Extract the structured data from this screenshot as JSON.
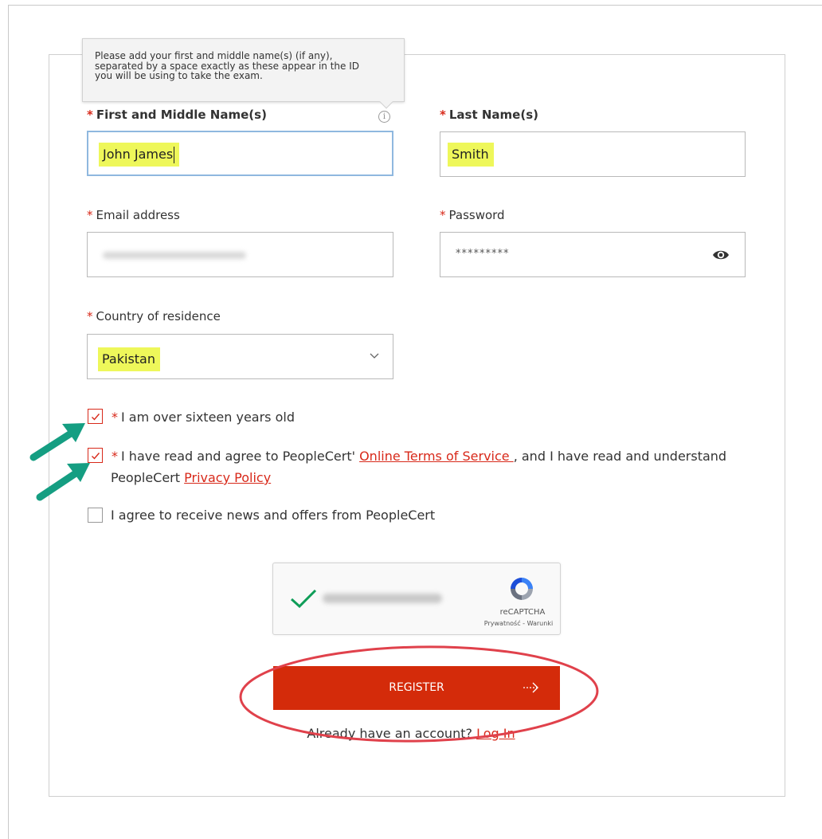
{
  "tooltip": {
    "lines": [
      "Please add your first and middle name(s) (if any),",
      "separated by a space exactly as these appear in the ID",
      "you will be using to take the exam."
    ]
  },
  "form": {
    "required_marker": "*",
    "first_name": {
      "label": "First and Middle Name(s)",
      "value": "John James"
    },
    "last_name": {
      "label": "Last Name(s)",
      "value": "Smith"
    },
    "email": {
      "label": "Email address",
      "value": ""
    },
    "password": {
      "label": "Password",
      "masked_value": "*********",
      "icon": "eye-icon"
    },
    "country": {
      "label": "Country of residence",
      "selected": "Pakistan"
    },
    "checkboxes": {
      "age": {
        "label": "I am over sixteen years old",
        "checked": true
      },
      "terms": {
        "prefix": "I have read and agree to PeopleCert'",
        "terms_link": "Online Terms of Service ",
        "middle": ", and I have read and understand",
        "line2_prefix": "PeopleCert",
        "privacy_link": "Privacy Policy",
        "checked": true
      },
      "news": {
        "label": "I agree to receive news and offers from PeopleCert",
        "checked": false
      }
    },
    "recaptcha": {
      "brand": "reCAPTCHA",
      "terms": "Prywatność - Warunki",
      "verified": true
    },
    "register_button": {
      "label": "REGISTER"
    },
    "login": {
      "prompt": "Already have an account?",
      "link": "Log In"
    }
  },
  "colors": {
    "accent": "#d42b0a",
    "required": "#d8291a",
    "highlight": "#eef75a",
    "annotation_arrow": "#159e82",
    "annotation_circle": "#e0414b",
    "captcha_check": "#0f9d58"
  }
}
